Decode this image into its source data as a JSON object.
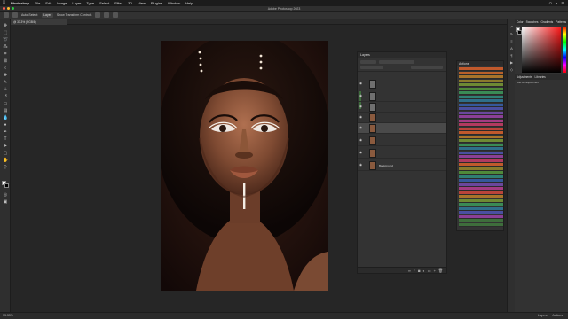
{
  "menubar": {
    "apple_icon": "apple-icon",
    "items": [
      "Photoshop",
      "File",
      "Edit",
      "Image",
      "Layer",
      "Type",
      "Select",
      "Filter",
      "3D",
      "View",
      "Plugins",
      "Window",
      "Help"
    ],
    "clock": "",
    "status_icons": [
      "wifi-icon",
      "search-icon",
      "control-center-icon"
    ]
  },
  "window": {
    "title": "Adobe Photoshop 2023",
    "traffic_lights": [
      "#ff5f57",
      "#febc2e",
      "#28c840"
    ]
  },
  "optionsbar": {
    "mode_label": "Auto-Select:",
    "mode_value": "Layer",
    "transform_label": "Show Transform Controls"
  },
  "document": {
    "tab_label": "@ 33.3% (RGB/8)"
  },
  "layers_panel": {
    "title": "Layers",
    "layers": [
      {
        "name": "",
        "visible": true,
        "thumb": "grey",
        "selected": false
      },
      {
        "name": "",
        "visible": true,
        "thumb": "grey",
        "selected": false
      },
      {
        "name": "",
        "visible": true,
        "thumb": "grey",
        "selected": false
      },
      {
        "name": "",
        "visible": true,
        "thumb": "photo",
        "selected": false
      },
      {
        "name": "",
        "visible": true,
        "thumb": "photo",
        "selected": true
      },
      {
        "name": "",
        "visible": true,
        "thumb": "photo",
        "selected": false
      },
      {
        "name": "",
        "visible": true,
        "thumb": "photo",
        "selected": false
      },
      {
        "name": "Background",
        "visible": true,
        "thumb": "photo",
        "selected": false
      }
    ]
  },
  "actions_panel": {
    "title": "Actions",
    "rows": [
      {
        "color": "#c0592c"
      },
      {
        "color": "#b8602a"
      },
      {
        "color": "#a8732a"
      },
      {
        "color": "#8a7a2c"
      },
      {
        "color": "#6e8a34"
      },
      {
        "color": "#4f8a3a"
      },
      {
        "color": "#3a8a55"
      },
      {
        "color": "#2f7f73"
      },
      {
        "color": "#2f6f8a"
      },
      {
        "color": "#35589a"
      },
      {
        "color": "#4a4fa0"
      },
      {
        "color": "#6a479c"
      },
      {
        "color": "#8b3f96"
      },
      {
        "color": "#a33b82"
      },
      {
        "color": "#b13a5f"
      },
      {
        "color": "#b9443a"
      },
      {
        "color": "#c0592c"
      },
      {
        "color": "#a8732a"
      },
      {
        "color": "#6e8a34"
      },
      {
        "color": "#3a8a55"
      },
      {
        "color": "#2f6f8a"
      },
      {
        "color": "#4a4fa0"
      },
      {
        "color": "#8b3f96"
      },
      {
        "color": "#b13a5f"
      },
      {
        "color": "#c0592c"
      },
      {
        "color": "#8a7a2c"
      },
      {
        "color": "#4f8a3a"
      },
      {
        "color": "#2f7f73"
      },
      {
        "color": "#35589a"
      },
      {
        "color": "#6a479c"
      },
      {
        "color": "#a33b82"
      },
      {
        "color": "#b9443a"
      },
      {
        "color": "#a8732a"
      },
      {
        "color": "#6e8a34"
      },
      {
        "color": "#3a8a55"
      },
      {
        "color": "#2f6f8a"
      },
      {
        "color": "#4a4fa0"
      },
      {
        "color": "#8b3f96"
      },
      {
        "color": "#3e6d3c"
      },
      {
        "color": "#3e6d3c"
      }
    ]
  },
  "color_panel": {
    "tabs": [
      "Color",
      "Swatches",
      "Gradients",
      "Patterns"
    ]
  },
  "adjustments_panel": {
    "tabs": [
      "Adjustments",
      "Libraries"
    ],
    "subtitle": "Add an adjustment"
  },
  "statusbar": {
    "zoom": "33.33%",
    "info": "",
    "right_items": [
      "Layers",
      "Actions"
    ]
  }
}
